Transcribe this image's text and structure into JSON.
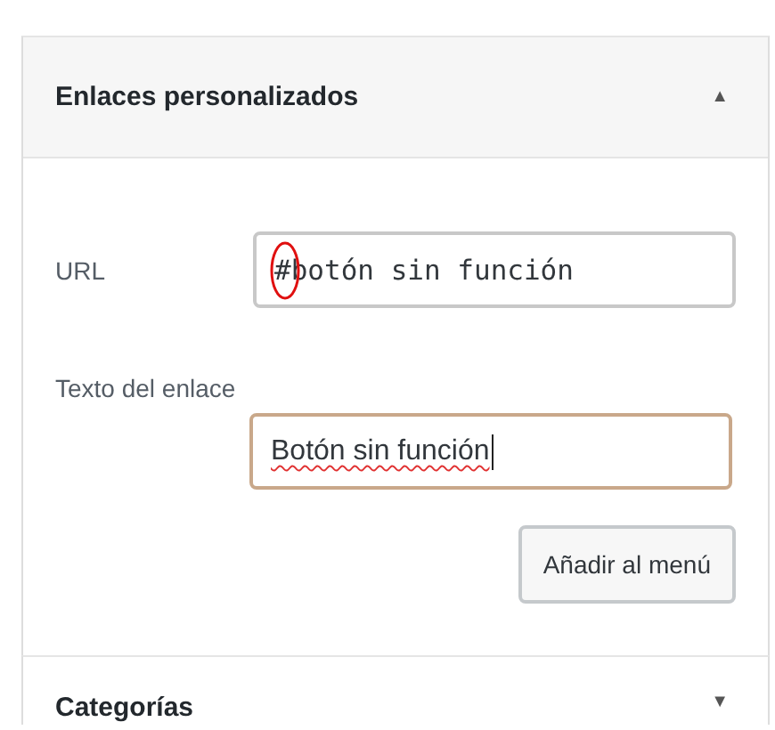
{
  "sections": [
    {
      "title": "Enlaces personalizados",
      "toggle": "▲",
      "expanded": true,
      "url": {
        "label": "URL",
        "value": "#botón sin función",
        "marked_first_char": true
      },
      "link_text": {
        "label": "Texto del enlace",
        "value": "Botón sin función",
        "focused": true,
        "misspelled": true
      },
      "button": "Añadir al menú"
    },
    {
      "title": "Categorías",
      "toggle": "▼",
      "expanded": false
    }
  ]
}
